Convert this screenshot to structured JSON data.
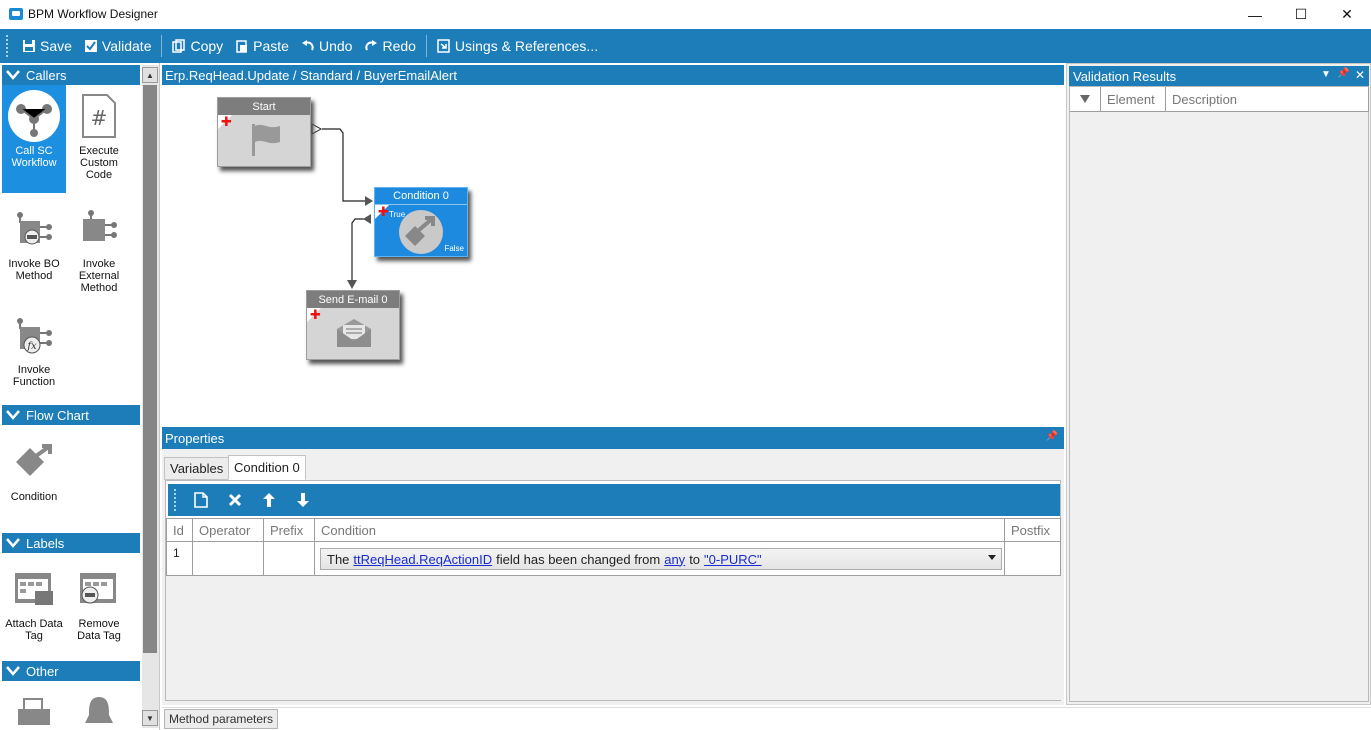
{
  "window": {
    "title": "BPM Workflow Designer",
    "minimize": "—",
    "maximize": "☐",
    "close": "✕"
  },
  "toolbar": {
    "save": "Save",
    "validate": "Validate",
    "copy": "Copy",
    "paste": "Paste",
    "undo": "Undo",
    "redo": "Redo",
    "usings": "Usings & References..."
  },
  "toolbox": {
    "groups": {
      "callers": "Callers",
      "flowchart": "Flow Chart",
      "labels": "Labels",
      "other": "Other"
    },
    "tools": {
      "call_sc": "Call SC Workflow",
      "execute_code": "Execute Custom Code",
      "invoke_bo": "Invoke BO Method",
      "invoke_external": "Invoke External Method",
      "invoke_function": "Invoke Function",
      "condition": "Condition",
      "attach_tag": "Attach Data Tag",
      "remove_tag": "Remove Data Tag"
    }
  },
  "canvas": {
    "breadcrumb": "Erp.ReqHead.Update / Standard / BuyerEmailAlert",
    "nodes": {
      "start": "Start",
      "condition": "Condition 0",
      "condition_true": "True",
      "condition_false": "False",
      "email": "Send E-mail 0"
    }
  },
  "properties": {
    "title": "Properties",
    "tabs": {
      "variables": "Variables",
      "condition": "Condition 0"
    },
    "columns": {
      "id": "Id",
      "operator": "Operator",
      "prefix": "Prefix",
      "condition": "Condition",
      "postfix": "Postfix"
    },
    "row": {
      "id": "1",
      "cond_the": "The",
      "cond_field": "ttReqHead.ReqActionID",
      "cond_mid": "field has been changed from",
      "cond_from": "any",
      "cond_to_word": "to",
      "cond_to": "\"0-PURC\""
    }
  },
  "validation": {
    "title": "Validation Results",
    "columns": {
      "element": "Element",
      "description": "Description"
    }
  },
  "status": {
    "method_params": "Method parameters"
  }
}
